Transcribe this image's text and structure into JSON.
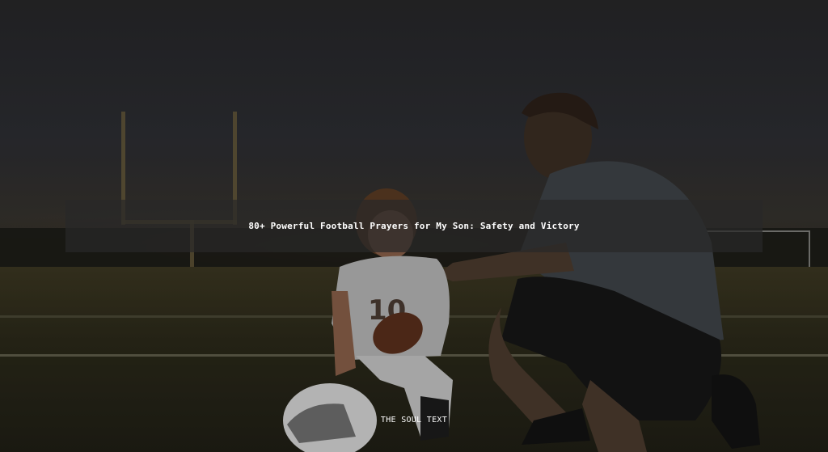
{
  "hero": {
    "title": "80+ Powerful Football Prayers for My Son: Safety and Victory",
    "brand": "THE SOUL TEXT"
  }
}
